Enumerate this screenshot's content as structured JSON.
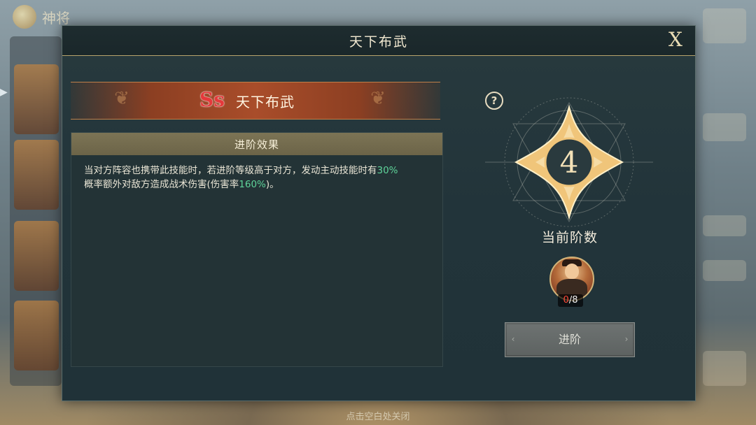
{
  "background": {
    "top_left_text": "神将",
    "bottom_hint": "点击空白处关闭"
  },
  "dialog": {
    "title": "天下布武",
    "close_label": "X"
  },
  "skill": {
    "rank": "Ss",
    "name": "天下布武"
  },
  "effect": {
    "header": "进阶效果",
    "line1_prefix": "当对方阵容也携带此技能时，若进阶等级高于对方，发动主动技能时有",
    "line1_value": "30%",
    "line2_prefix": "概率额外对敌方造成战术伤害(伤害率",
    "line2_value": "160%",
    "line2_suffix": ")。"
  },
  "stage": {
    "number": "4",
    "label": "当前阶数"
  },
  "material": {
    "owned": "0",
    "required": "/8"
  },
  "advance_button": {
    "label": "进阶"
  },
  "colors": {
    "highlight": "#5fd49a",
    "emblem_gold": "#f0c57a",
    "rank_red": "#e5393b"
  }
}
